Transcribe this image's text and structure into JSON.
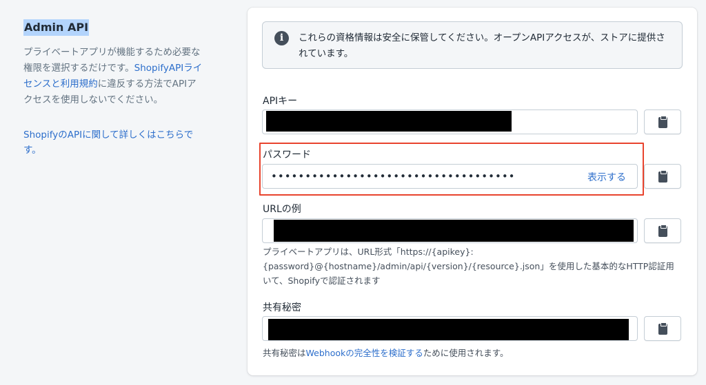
{
  "sidebar": {
    "title": "Admin API",
    "description_1": "プライベートアプリが機能するため必要な権限を選択するだけです。",
    "license_link": "ShopifyAPIライセンスと利用規約",
    "description_2": "に違反する方法でAPIアクセスを使用しないでください。",
    "learn_more": "ShopifyのAPIに関して詳しくはこちらです。"
  },
  "banner": {
    "icon": "info-icon",
    "text": "これらの資格情報は安全に保管してください。オープンAPIアクセスが、ストアに提供されています。"
  },
  "fields": {
    "api_key": {
      "label": "APIキー",
      "value_hidden": true
    },
    "password": {
      "label": "パスワード",
      "value": "••••••••••••••••••••••••••••••••••••",
      "show_label": "表示する"
    },
    "example_url": {
      "label": "URLの例",
      "value_hidden": true,
      "help": "プライベートアプリは、URL形式「https://{apikey}:{password}@{hostname}/admin/api/{version}/{resource}.json」を使用した基本的なHTTP認証用いて、Shopifyで認証されます"
    },
    "shared_secret": {
      "label": "共有秘密",
      "value_hidden": true,
      "help_prefix": "共有秘密は",
      "help_link": "Webhookの完全性を検証する",
      "help_suffix": "ために使用されます。"
    }
  },
  "copy_icon": "clipboard-icon",
  "colors": {
    "link": "#2c6ecb",
    "highlight_border": "#e8432d",
    "title_highlight": "#b3d4fc",
    "background": "#f4f6f8"
  }
}
